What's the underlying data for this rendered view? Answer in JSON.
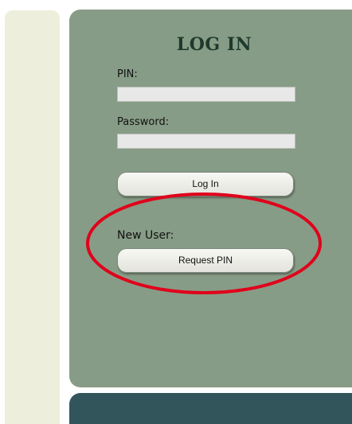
{
  "login": {
    "title": "LOG IN",
    "pin_label": "PIN:",
    "pin_value": "",
    "password_label": "Password:",
    "password_value": "",
    "login_button": "Log In"
  },
  "new_user": {
    "label": "New User:",
    "request_pin_button": "Request PIN"
  },
  "colors": {
    "panel_green": "#879c86",
    "panel_dark": "#32555c",
    "left_strip": "#eeeedd",
    "highlight_red": "#e0001b",
    "title_color": "#1e3a2c"
  }
}
